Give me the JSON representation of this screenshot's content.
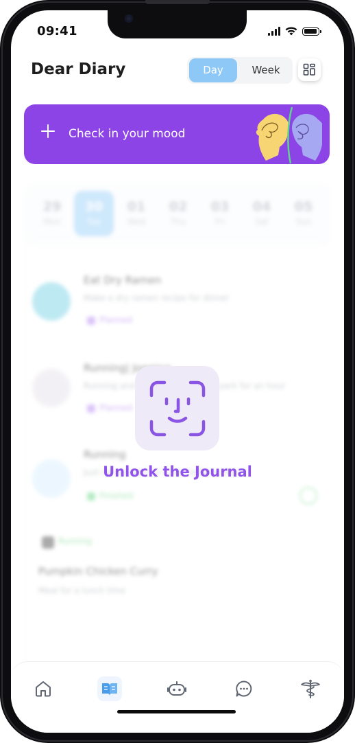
{
  "status_bar": {
    "time": "09:41"
  },
  "header": {
    "title": "Dear Diary"
  },
  "view_toggle": {
    "day_label": "Day",
    "week_label": "Week",
    "selected": "Day"
  },
  "mood_banner": {
    "label": "Check in your mood"
  },
  "week": {
    "days": [
      {
        "num": "29",
        "weekday": "Mon"
      },
      {
        "num": "30",
        "weekday": "Tue",
        "selected": true
      },
      {
        "num": "01",
        "weekday": "Wed"
      },
      {
        "num": "02",
        "weekday": "Thu"
      },
      {
        "num": "03",
        "weekday": "Fri"
      },
      {
        "num": "04",
        "weekday": "Sat"
      },
      {
        "num": "05",
        "weekday": "Sun"
      }
    ]
  },
  "entries": [
    {
      "title": "Eat Dry Ramen",
      "subtitle": "Make a dry ramen recipe for dinner",
      "tag": "Planned"
    },
    {
      "title": "Running| Jogging",
      "subtitle": "Running and jogging around the park for an hour",
      "tag": "Planned"
    },
    {
      "title": "Running",
      "subtitle": "Just ran around for a bit, nothing else",
      "tag": "Finished"
    },
    {
      "title": "Pumpkin Chicken Curry",
      "subtitle": "Meal for a lunch time",
      "tag": "Running"
    }
  ],
  "lock": {
    "label": "Unlock the Journal"
  },
  "colors": {
    "accent_purple": "#8c44e6",
    "day_selected": "#8ec8f7",
    "unlock_text": "#9154ea"
  },
  "tabbar": {
    "items": [
      {
        "icon": "home-icon"
      },
      {
        "icon": "book-icon",
        "active": true
      },
      {
        "icon": "robot-icon"
      },
      {
        "icon": "chat-icon"
      },
      {
        "icon": "caduceus-icon"
      }
    ]
  }
}
